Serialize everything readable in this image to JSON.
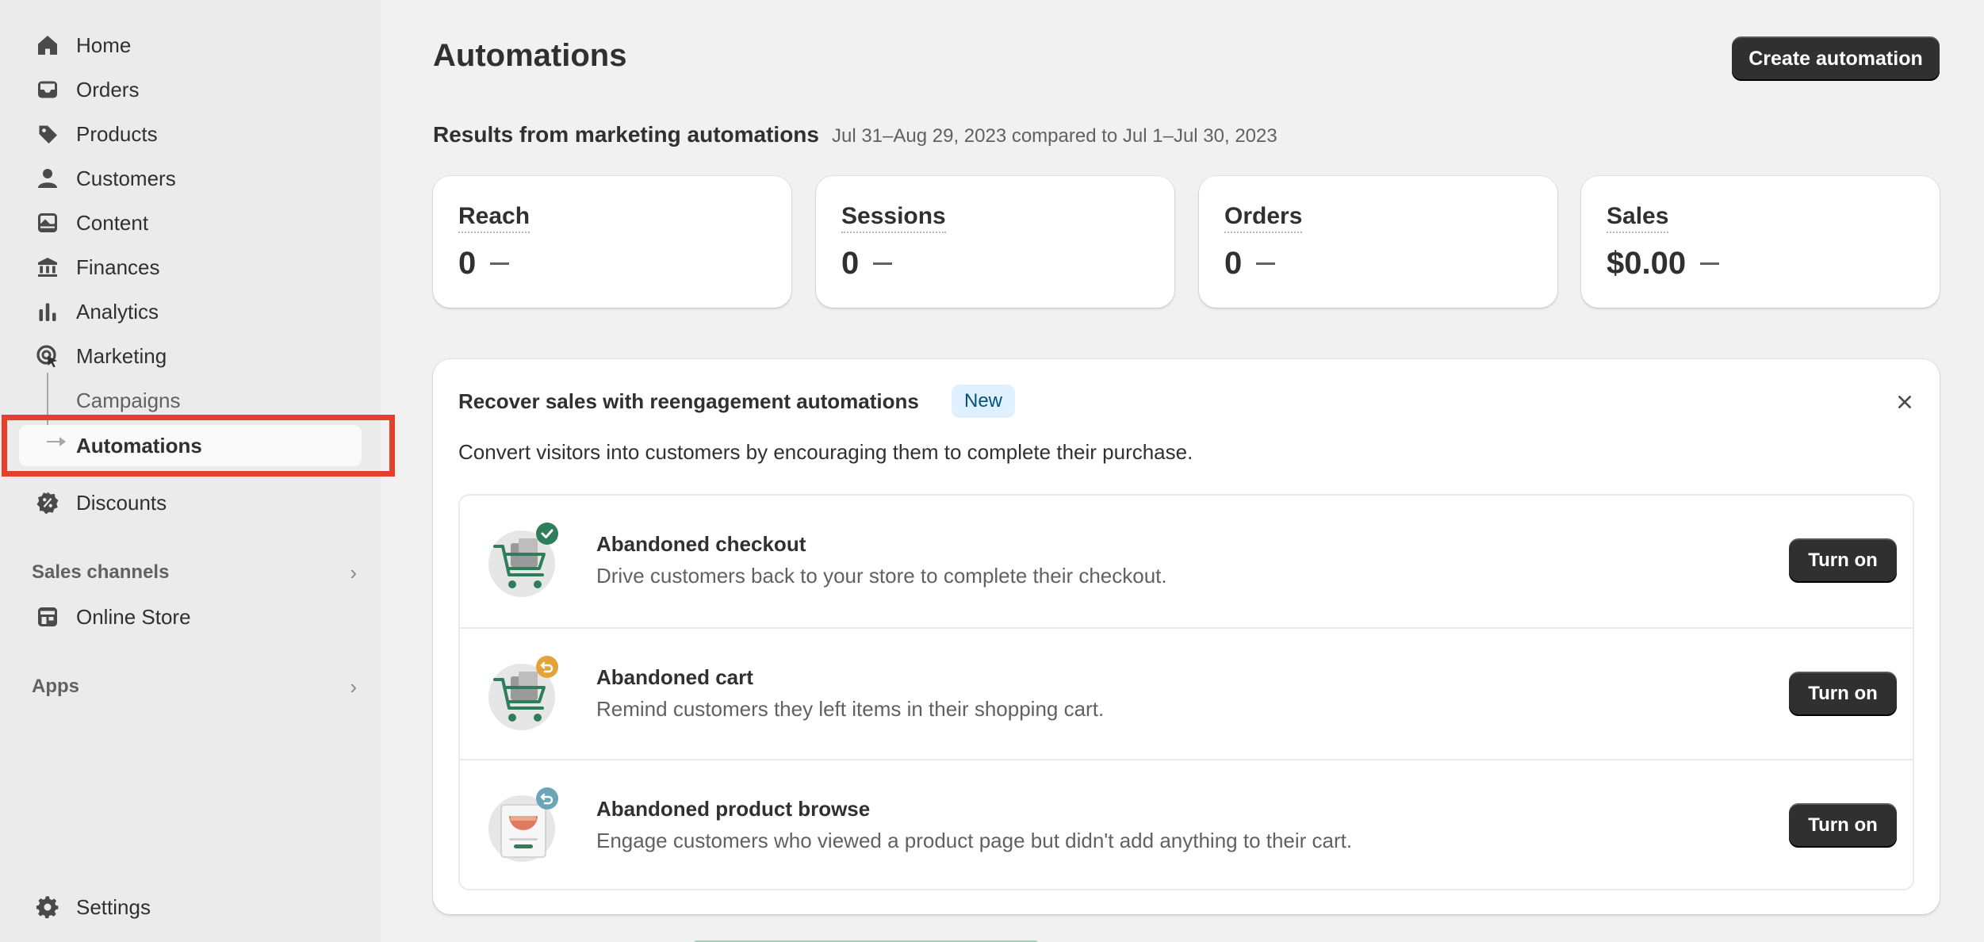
{
  "sidebar": {
    "items": [
      {
        "label": "Home",
        "icon": "home-icon"
      },
      {
        "label": "Orders",
        "icon": "inbox-icon"
      },
      {
        "label": "Products",
        "icon": "tag-icon"
      },
      {
        "label": "Customers",
        "icon": "person-icon"
      },
      {
        "label": "Content",
        "icon": "image-icon"
      },
      {
        "label": "Finances",
        "icon": "bank-icon"
      },
      {
        "label": "Analytics",
        "icon": "bar-chart-icon"
      },
      {
        "label": "Marketing",
        "icon": "target-icon"
      }
    ],
    "marketing_sub": {
      "campaigns": "Campaigns",
      "automations": "Automations"
    },
    "discounts": {
      "label": "Discounts",
      "icon": "discount-icon"
    },
    "sales_channels": {
      "label": "Sales channels"
    },
    "online_store": {
      "label": "Online Store",
      "icon": "store-icon"
    },
    "apps": {
      "label": "Apps"
    },
    "settings": {
      "label": "Settings",
      "icon": "gear-icon"
    }
  },
  "header": {
    "title": "Automations",
    "create_button": "Create automation"
  },
  "results": {
    "title": "Results from marketing automations",
    "date_range": "Jul 31–Aug 29, 2023 compared to Jul 1–Jul 30, 2023"
  },
  "metrics": [
    {
      "label": "Reach",
      "value": "0"
    },
    {
      "label": "Sessions",
      "value": "0"
    },
    {
      "label": "Orders",
      "value": "0"
    },
    {
      "label": "Sales",
      "value": "$0.00"
    }
  ],
  "recover": {
    "title": "Recover sales with reengagement automations",
    "badge": "New",
    "description": "Convert visitors into customers by encouraging them to complete their purchase.",
    "automations": [
      {
        "title": "Abandoned checkout",
        "description": "Drive customers back to your store to complete their checkout.",
        "button": "Turn on",
        "icon": "cart-check-icon"
      },
      {
        "title": "Abandoned cart",
        "description": "Remind customers they left items in their shopping cart.",
        "button": "Turn on",
        "icon": "cart-return-icon"
      },
      {
        "title": "Abandoned product browse",
        "description": "Engage customers who viewed a product page but didn't add anything to their cart.",
        "button": "Turn on",
        "icon": "product-page-icon"
      }
    ]
  },
  "colors": {
    "accent_dark": "#303030",
    "highlight": "#e4402c",
    "badge_bg": "#e0f0ff",
    "check_green": "#2e7d5b",
    "return_orange": "#e3a23a",
    "return_teal": "#6aa6b8"
  }
}
